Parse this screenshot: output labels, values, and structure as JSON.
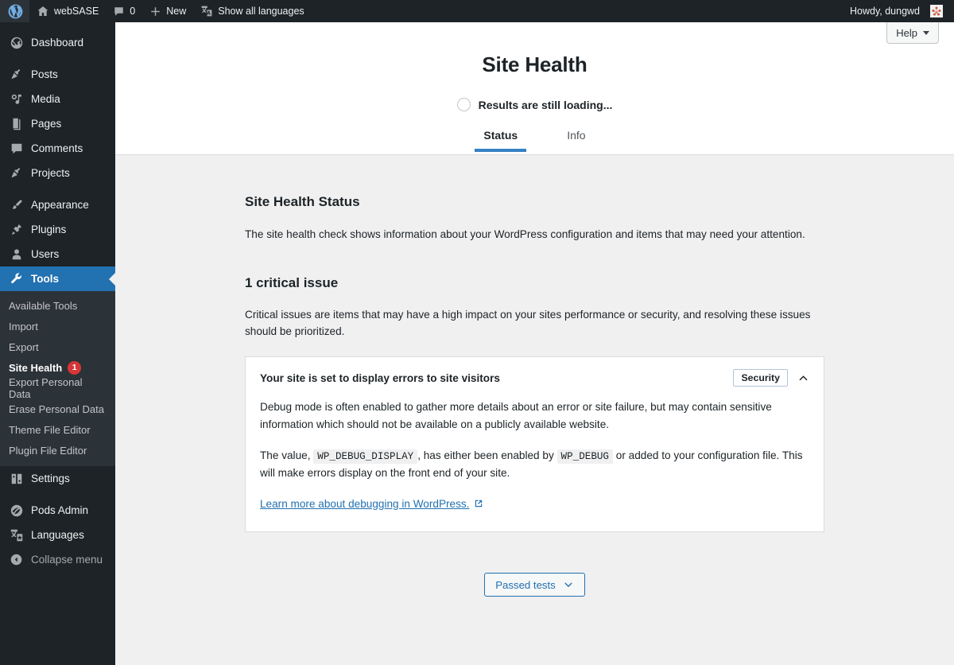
{
  "adminbar": {
    "wp_logo": "wordpress-logo-icon",
    "site_name": "webSASE",
    "comments_label": "0",
    "new_label": "New",
    "languages_label": "Show all languages",
    "howdy": "Howdy, dungwd"
  },
  "sidebar": {
    "items": [
      {
        "label": "Dashboard",
        "icon": "dashboard-icon",
        "current": false
      },
      {
        "label": "Posts",
        "icon": "pin-icon",
        "current": false
      },
      {
        "label": "Media",
        "icon": "media-icon",
        "current": false
      },
      {
        "label": "Pages",
        "icon": "pages-icon",
        "current": false
      },
      {
        "label": "Comments",
        "icon": "comment-icon",
        "current": false
      },
      {
        "label": "Projects",
        "icon": "pin-icon",
        "current": false
      },
      {
        "label": "Appearance",
        "icon": "brush-icon",
        "current": false
      },
      {
        "label": "Plugins",
        "icon": "plugin-icon",
        "current": false
      },
      {
        "label": "Users",
        "icon": "user-icon",
        "current": false
      },
      {
        "label": "Tools",
        "icon": "wrench-icon",
        "current": true
      },
      {
        "label": "Settings",
        "icon": "settings-icon",
        "current": false
      },
      {
        "label": "Pods Admin",
        "icon": "pods-icon",
        "current": false
      },
      {
        "label": "Languages",
        "icon": "languages-icon",
        "current": false
      }
    ],
    "tools_submenu": [
      {
        "label": "Available Tools",
        "current": false,
        "badge": ""
      },
      {
        "label": "Import",
        "current": false,
        "badge": ""
      },
      {
        "label": "Export",
        "current": false,
        "badge": ""
      },
      {
        "label": "Site Health",
        "current": true,
        "badge": "1"
      },
      {
        "label": "Export Personal Data",
        "current": false,
        "badge": ""
      },
      {
        "label": "Erase Personal Data",
        "current": false,
        "badge": ""
      },
      {
        "label": "Theme File Editor",
        "current": false,
        "badge": ""
      },
      {
        "label": "Plugin File Editor",
        "current": false,
        "badge": ""
      }
    ],
    "collapse_label": "Collapse menu",
    "badge_color": "#d63638",
    "current_color": "#2271b1"
  },
  "header": {
    "help_label": "Help",
    "page_title": "Site Health",
    "loading_text": "Results are still loading...",
    "tabs": [
      {
        "label": "Status",
        "active": true
      },
      {
        "label": "Info",
        "active": false
      }
    ],
    "active_tab_color": "#3582c4"
  },
  "main": {
    "status_heading": "Site Health Status",
    "status_description": "The site health check shows information about your WordPress configuration and items that may need your attention.",
    "issue_heading": "1 critical issue",
    "issue_description": "Critical issues are items that may have a high impact on your sites performance or security, and resolving these issues should be prioritized.",
    "accordion": {
      "title": "Your site is set to display errors to site visitors",
      "badge": "Security",
      "toggle_icon": "chevron-up-icon",
      "paragraph_1": "Debug mode is often enabled to gather more details about an error or site failure, but may contain sensitive information which should not be available on a publicly available website.",
      "paragraph_2_part1": "The value,",
      "code_1": "WP_DEBUG_DISPLAY",
      "paragraph_2_part2": ", has either been enabled by",
      "code_2": "WP_DEBUG",
      "paragraph_2_part3": "or added to your configuration file. This will make errors display on the front end of your site.",
      "link_text": "Learn more about debugging in WordPress.",
      "link_icon": "external-link-icon"
    },
    "passed_tests_label": "Passed tests",
    "passed_tests_icon": "chevron-down-icon",
    "link_color": "#2271b1"
  }
}
